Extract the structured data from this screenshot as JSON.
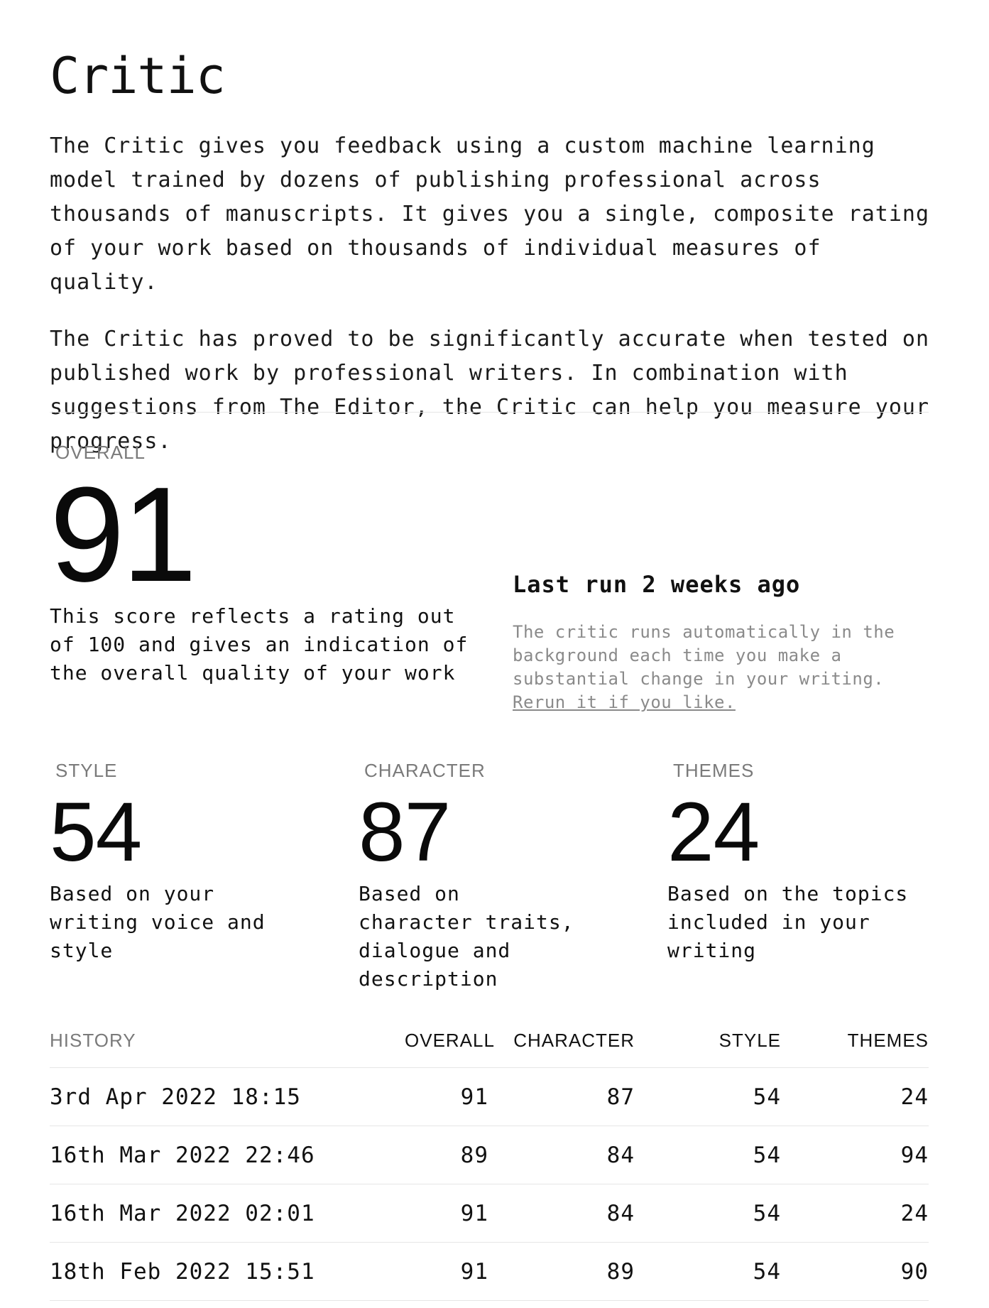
{
  "title": "Critic",
  "intro": {
    "p1": "The Critic gives you feedback using a custom machine learning model trained by dozens of publishing professional across thousands of manuscripts. It gives you a single, composite rating of your work based on thousands of individual measures of quality.",
    "p2": "The Critic has proved to be significantly accurate when tested on published work by professional writers. In combination with suggestions from The Editor, the Critic can help you measure your progress."
  },
  "overall": {
    "label": "OVERALL",
    "value": "91",
    "description": "This score reflects a rating out of 100 and gives an indication of the overall quality of your work"
  },
  "last_run": {
    "title": "Last run 2 weeks ago",
    "description": "The critic runs automatically in the background each time you make a substantial change in your writing.",
    "rerun_link": "Rerun it if you like."
  },
  "metrics": {
    "style": {
      "label": "STYLE",
      "value": "54",
      "description": "Based on your writing voice and style"
    },
    "character": {
      "label": "CHARACTER",
      "value": "87",
      "description": "Based on character traits, dialogue and description"
    },
    "themes": {
      "label": "THEMES",
      "value": "24",
      "description": "Based on the topics included in your writing"
    }
  },
  "history": {
    "headers": {
      "date": "HISTORY",
      "overall": "OVERALL",
      "character": "CHARACTER",
      "style": "STYLE",
      "themes": "THEMES"
    },
    "rows": [
      {
        "date": "3rd Apr 2022 18:15",
        "overall": "91",
        "character": "87",
        "style": "54",
        "themes": "24"
      },
      {
        "date": "16th Mar 2022 22:46",
        "overall": "89",
        "character": "84",
        "style": "54",
        "themes": "94"
      },
      {
        "date": "16th Mar 2022 02:01",
        "overall": "91",
        "character": "84",
        "style": "54",
        "themes": "24"
      },
      {
        "date": "18th Feb 2022 15:51",
        "overall": "91",
        "character": "89",
        "style": "54",
        "themes": "90"
      }
    ]
  }
}
